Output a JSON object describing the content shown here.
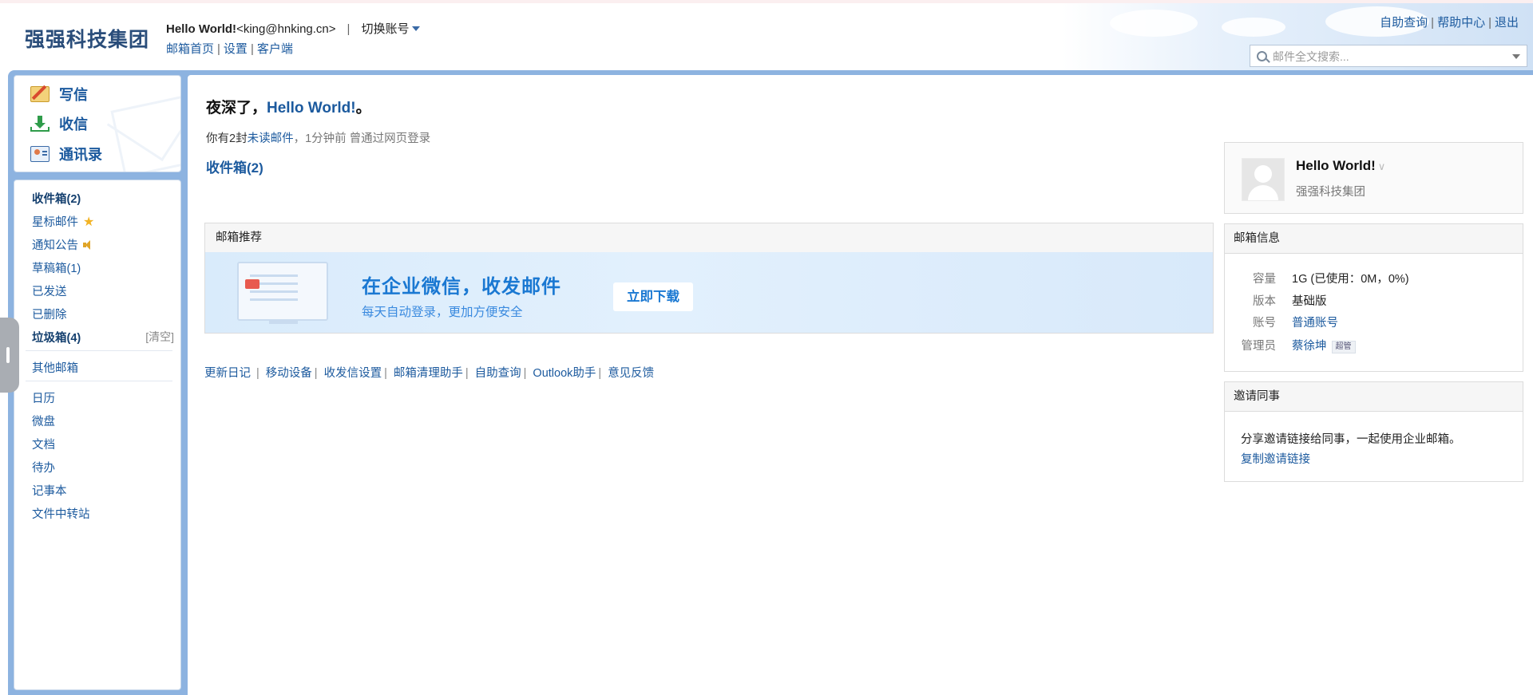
{
  "header": {
    "logo_text": "强强科技集团",
    "user_name": "Hello World!",
    "user_email": "<king@hnking.cn>",
    "switch_account": "切换账号",
    "links": [
      "邮箱首页",
      "设置",
      "客户端"
    ],
    "right_links": [
      "自助查询",
      "帮助中心",
      "退出"
    ],
    "search_placeholder": "邮件全文搜索..."
  },
  "sidebar": {
    "actions": [
      {
        "label": "写信",
        "icon": "compose-icon"
      },
      {
        "label": "收信",
        "icon": "receive-icon"
      },
      {
        "label": "通讯录",
        "icon": "contacts-icon"
      }
    ],
    "folders": {
      "inbox": "收件箱(2)",
      "starred": "星标邮件",
      "notice": "通知公告",
      "drafts": "草稿箱(1)",
      "sent": "已发送",
      "deleted": "已删除",
      "spam": "垃圾箱(4)",
      "spam_clear": "[清空]",
      "other": "其他邮箱"
    },
    "apps": [
      "日历",
      "微盘",
      "文档",
      "待办",
      "记事本",
      "文件中转站"
    ]
  },
  "main": {
    "greeting_prefix": "夜深了，",
    "greeting_name": "Hello World!",
    "greeting_suffix": "。",
    "unread_prefix": "你有2封",
    "unread_link": "未读邮件",
    "unread_suffix": "，1分钟前 曾通过网页登录",
    "inbox_title": "收件箱(2)",
    "recommend": {
      "title": "邮箱推荐",
      "banner_title": "在企业微信，收发邮件",
      "banner_sub": "每天自动登录，更加方便安全",
      "banner_button": "立即下载"
    },
    "footer_links": [
      "更新日记",
      "移动设备",
      "收发信设置",
      "邮箱清理助手",
      "自助查询",
      "Outlook助手",
      "意见反馈"
    ]
  },
  "profile": {
    "name": "Hello World!",
    "org": "强强科技集团"
  },
  "mailbox_info": {
    "title": "邮箱信息",
    "capacity_label": "容量",
    "capacity_value": "1G (已使用：0M，0%)",
    "version_label": "版本",
    "version_value": "基础版",
    "account_label": "账号",
    "account_value": "普通账号",
    "admin_label": "管理员",
    "admin_value": "蔡徐坤",
    "admin_badge": "超管"
  },
  "invite": {
    "title": "邀请同事",
    "text": "分享邀请链接给同事，一起使用企业邮箱。",
    "link": "复制邀请链接"
  }
}
